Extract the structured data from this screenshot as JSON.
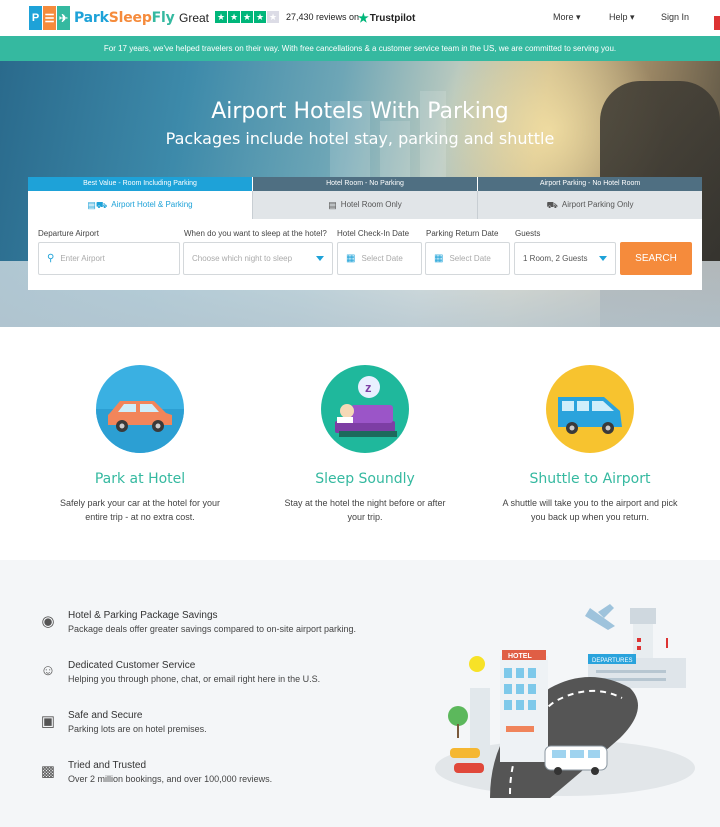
{
  "header": {
    "logo_text_park": "Park",
    "logo_text_sleep": "Sleep",
    "logo_text_fly": "Fly",
    "rating_word": "Great",
    "review_count": "27,430 reviews on",
    "trustpilot": "Trustpilot",
    "nav_more": "More",
    "nav_help": "Help",
    "nav_signin": "Sign In"
  },
  "promo_text": "For 17 years, we've helped travelers on their way. With free cancellations & a customer service team in the US, we are committed to serving you.",
  "hero": {
    "title": "Airport Hotels With Parking",
    "subtitle": "Packages include hotel stay, parking and shuttle"
  },
  "booking": {
    "tabs": [
      {
        "top_label": "Best Value - Room Including Parking",
        "label": "Airport Hotel & Parking"
      },
      {
        "top_label": "Hotel Room - No Parking",
        "label": "Hotel Room Only"
      },
      {
        "top_label": "Airport Parking - No Hotel Room",
        "label": "Airport Parking Only"
      }
    ],
    "fields": {
      "departure_label": "Departure Airport",
      "departure_placeholder": "Enter Airport",
      "night_label": "When do you want to sleep at the hotel?",
      "night_placeholder": "Choose which night to sleep",
      "checkin_label": "Hotel Check-In Date",
      "checkin_placeholder": "Select Date",
      "return_label": "Parking Return Date",
      "return_placeholder": "Select Date",
      "guests_label": "Guests",
      "guests_value": "1 Room, 2 Guests"
    },
    "search_label": "SEARCH"
  },
  "features": [
    {
      "title": "Park at Hotel",
      "text": "Safely park your car at the hotel for your entire trip - at no extra cost."
    },
    {
      "title": "Sleep Soundly",
      "text": "Stay at the hotel the night before or after your trip."
    },
    {
      "title": "Shuttle to Airport",
      "text": "A shuttle will take you to the airport and pick you back up when you return."
    }
  ],
  "benefits": [
    {
      "title": "Hotel & Parking Package Savings",
      "text": "Package deals offer greater savings compared to on-site airport parking.",
      "icon": "piggy-bank-icon"
    },
    {
      "title": "Dedicated Customer Service",
      "text": "Helping you through phone, chat, or email right here in the U.S.",
      "icon": "headset-icon"
    },
    {
      "title": "Safe and Secure",
      "text": "Parking lots are on hotel premises.",
      "icon": "lock-icon"
    },
    {
      "title": "Tried and Trusted",
      "text": "Over 2 million bookings, and over 100,000 reviews.",
      "icon": "building-icon"
    }
  ],
  "illustration": {
    "hotel_sign": "HOTEL",
    "departures_sign": "DEPARTURES"
  },
  "colors": {
    "teal": "#35b9a0",
    "blue": "#1ea2d8",
    "orange": "#f58b3c",
    "trustpilot_green": "#00b67a"
  },
  "rating": {
    "stars_filled": 4,
    "stars_total": 5
  }
}
